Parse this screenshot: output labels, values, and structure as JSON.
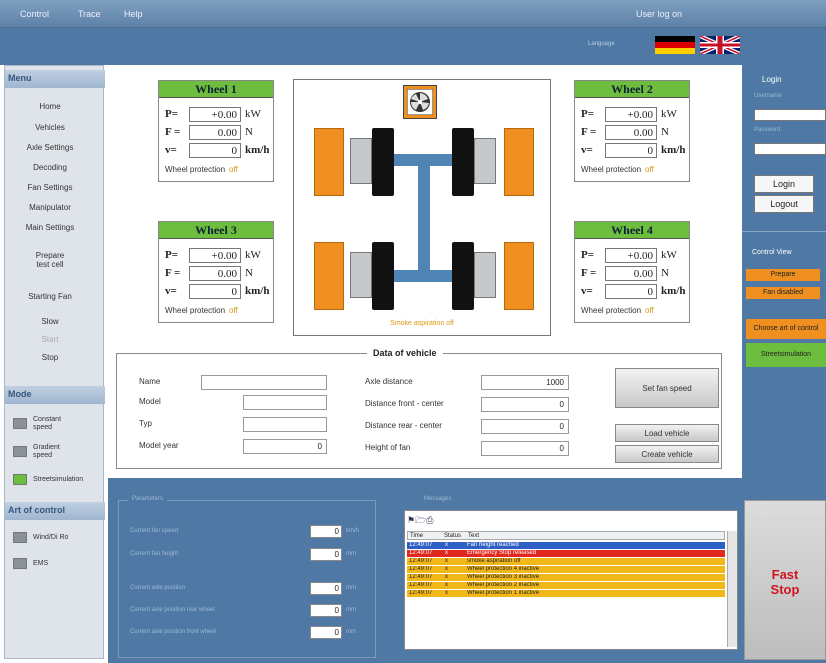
{
  "topbar": {
    "menu": [
      "Control",
      "Trace",
      "Help"
    ],
    "user": "User log on"
  },
  "language": {
    "label": "Language"
  },
  "sidebar": {
    "menu_title": "Menu",
    "items": [
      "Home",
      "Vehicles",
      "Axle Settings",
      "Decoding",
      "Fan Settings",
      "Manipulator",
      "Main Settings"
    ],
    "prepare": "Prepare\ntest cell",
    "starting_fan": "Starting Fan",
    "slow": "Slow",
    "start": "Start",
    "stop": "Stop",
    "mode_title": "Mode",
    "modes": [
      "Constant\nspeed",
      "Gradient\nspeed",
      "Streetsimulation"
    ],
    "art_title": "Art of control",
    "arts": [
      "Wind/Di Ro",
      "EMS"
    ]
  },
  "wheels": [
    {
      "title": "Wheel 1",
      "p": "+0.00",
      "p_unit": "kW",
      "f": "0.00",
      "f_unit": "N",
      "v": "0",
      "v_unit": "km/h",
      "prot_label": "Wheel protection",
      "prot_state": "off"
    },
    {
      "title": "Wheel 2",
      "p": "+0.00",
      "p_unit": "kW",
      "f": "0.00",
      "f_unit": "N",
      "v": "0",
      "v_unit": "km/h",
      "prot_label": "Wheel protection",
      "prot_state": "off"
    },
    {
      "title": "Wheel 3",
      "p": "+0.00",
      "p_unit": "kW",
      "f": "0.00",
      "f_unit": "N",
      "v": "0",
      "v_unit": "km/h",
      "prot_label": "Wheel protection",
      "prot_state": "off"
    },
    {
      "title": "Wheel 4",
      "p": "+0.00",
      "p_unit": "kW",
      "f": "0.00",
      "f_unit": "N",
      "v": "0",
      "v_unit": "km/h",
      "prot_label": "Wheel protection",
      "prot_state": "off"
    }
  ],
  "row_labels": {
    "p": "P=",
    "f": "F =",
    "v": "v="
  },
  "diagram": {
    "aspiration": "Smoke aspiration off"
  },
  "vehicle": {
    "title": "Data of vehicle",
    "name_label": "Name",
    "model_label": "Model",
    "type_label": "Typ",
    "year_label": "Model year",
    "year": "0",
    "axle_label": "Axle distance",
    "axle": "1000",
    "front_label": "Distance front - center",
    "front": "0",
    "rear_label": "Distance rear - center",
    "rear": "0",
    "fan_label": "Height of fan",
    "fan": "0",
    "set_fan": "Set fan speed",
    "load": "Load vehicle",
    "create": "Create vehicle"
  },
  "right": {
    "login_title": "Login",
    "user_label": "Username",
    "pass_label": "Password",
    "login": "Login",
    "logout": "Logout",
    "control_title": "Control View",
    "prepare": "Prepare",
    "fan_disabled": "Fan disabled",
    "choose": "Choose art of control",
    "street": "Streetsimulation"
  },
  "bottom": {
    "group1": "Parameters",
    "params": [
      {
        "label": "Current fan speed",
        "value": "0",
        "unit": "km/h"
      },
      {
        "label": "Current fan height",
        "value": "0",
        "unit": "mm"
      },
      {
        "label": "Current axle position",
        "value": "0",
        "unit": "mm"
      },
      {
        "label": "Current axle position rear wheel",
        "value": "0",
        "unit": "mm"
      },
      {
        "label": "Current axle position front wheel",
        "value": "0",
        "unit": "mm"
      }
    ],
    "group2": "Messages",
    "cols": [
      "Time",
      "Status",
      "Text"
    ],
    "messages": [
      {
        "time": "12:49:07",
        "status": "x",
        "text": "Fan height reached",
        "color": "#2d5fc4",
        "tc": "#fff"
      },
      {
        "time": "12:49:07",
        "status": "x",
        "text": "Emergency Stop released",
        "color": "#e0281e",
        "tc": "#fff"
      },
      {
        "time": "12:49:07",
        "status": "x",
        "text": "smoke aspiration off",
        "color": "#f2b718",
        "tc": "#222"
      },
      {
        "time": "12:49:07",
        "status": "x",
        "text": "Wheel protection 4 inactive",
        "color": "#f2b718",
        "tc": "#222"
      },
      {
        "time": "12:49:07",
        "status": "x",
        "text": "Wheel protection 3 inactive",
        "color": "#f2b718",
        "tc": "#222"
      },
      {
        "time": "12:49:07",
        "status": "x",
        "text": "Wheel protection 2 inactive",
        "color": "#f2b718",
        "tc": "#222"
      },
      {
        "time": "12:49:07",
        "status": "x",
        "text": "Wheel protection 1 inactive",
        "color": "#f2b718",
        "tc": "#222"
      }
    ],
    "fast_stop": "Fast\nStop"
  }
}
